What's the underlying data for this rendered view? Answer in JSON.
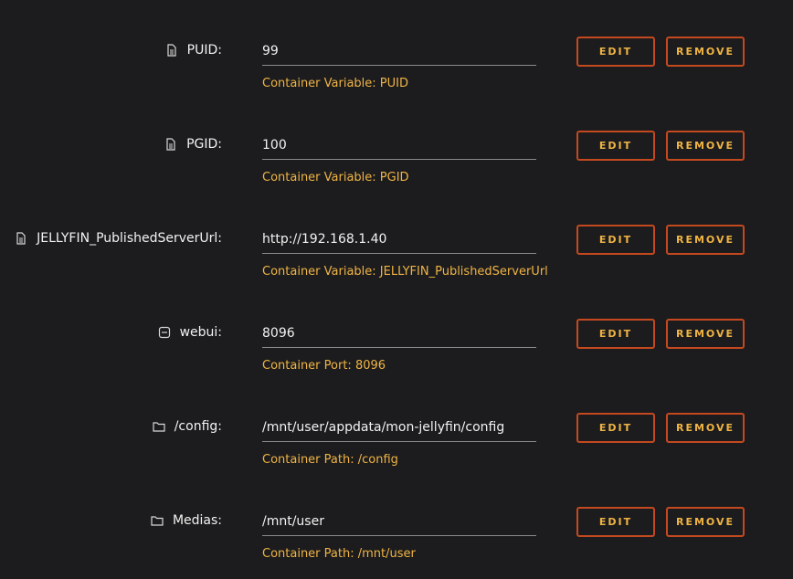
{
  "labels": {
    "edit": "EDIT",
    "remove": "REMOVE"
  },
  "rows": [
    {
      "icon": "file-icon",
      "label": "PUID:",
      "value": "99",
      "hint": "Container Variable: PUID"
    },
    {
      "icon": "file-icon",
      "label": "PGID:",
      "value": "100",
      "hint": "Container Variable: PGID"
    },
    {
      "icon": "file-icon",
      "label": "JELLYFIN_PublishedServerUrl:",
      "value": "http://192.168.1.40",
      "hint": "Container Variable: JELLYFIN_PublishedServerUrl"
    },
    {
      "icon": "port-icon",
      "label": "webui:",
      "value": "8096",
      "hint": "Container Port: 8096"
    },
    {
      "icon": "folder-icon",
      "label": "/config:",
      "value": "/mnt/user/appdata/mon-jellyfin/config",
      "hint": "Container Path: /config"
    },
    {
      "icon": "folder-icon",
      "label": "Medias:",
      "value": "/mnt/user",
      "hint": "Container Path: /mnt/user"
    }
  ],
  "colors": {
    "background": "#1c1c1e",
    "accent": "#f0b444",
    "button_border": "#c4491f"
  }
}
